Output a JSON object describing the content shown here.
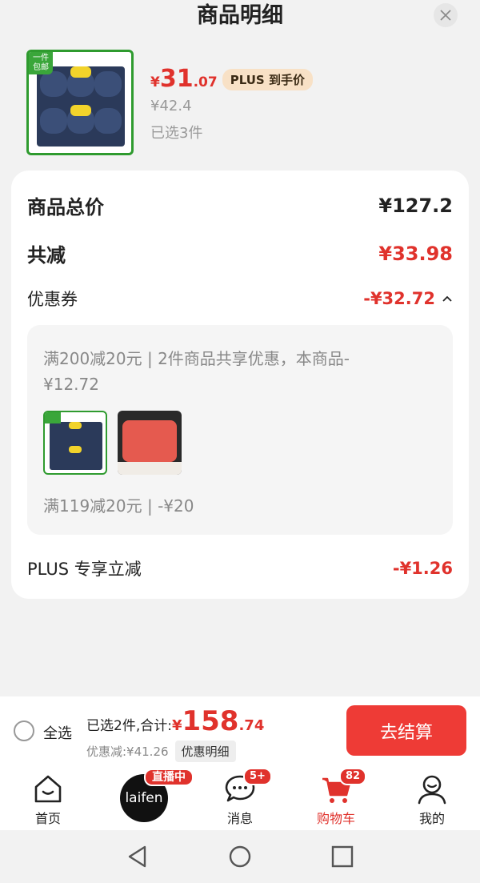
{
  "sheet": {
    "title": "商品明细"
  },
  "product": {
    "yen": "¥",
    "price_int": "31",
    "price_dec": ".07",
    "plus_tag": "PLUS 到手价",
    "original_price": "¥42.4",
    "selected": "已选3件",
    "thumb_badge": "一件\n包邮"
  },
  "summary": {
    "total_label": "商品总价",
    "total_value": "¥127.2",
    "reduce_label": "共减",
    "reduce_value": "¥33.98",
    "coupon_label": "优惠券",
    "coupon_value": "-¥32.72",
    "coupon_desc1": "满200减20元 | 2件商品共享优惠，本商品-¥12.72",
    "coupon_desc2": "满119减20元 | -¥20",
    "plus_label": "PLUS 专享立减",
    "plus_value": "-¥1.26"
  },
  "bottom_bar": {
    "select_all": "全选",
    "total_prefix": "已选2件,合计:",
    "yen": "¥",
    "total_int": "158",
    "total_dec": ".74",
    "discount": "优惠减:¥41.26",
    "detail_tag": "优惠明细",
    "checkout": "去结算"
  },
  "tabbar": {
    "home": "首页",
    "live_badge": "直播中",
    "live_logo": "laifen",
    "messages": "消息",
    "messages_badge": "5+",
    "cart": "购物车",
    "cart_badge": "82",
    "mine": "我的"
  },
  "colors": {
    "accent": "#e0322c",
    "checkout": "#ee3b36",
    "plus_tag_bg": "#f8e1c6"
  }
}
